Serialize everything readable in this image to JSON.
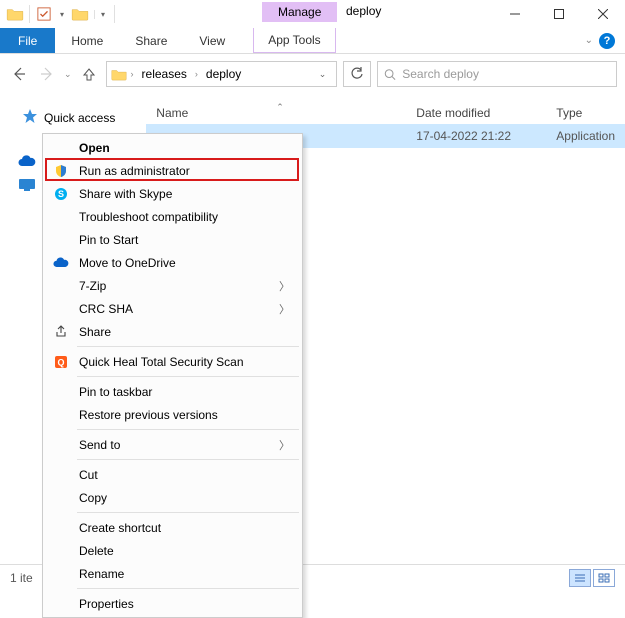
{
  "window": {
    "manage_tab": "Manage",
    "app_tools": "App Tools",
    "title": "deploy"
  },
  "ribbon": {
    "file": "File",
    "home": "Home",
    "share": "Share",
    "view": "View"
  },
  "nav": {
    "breadcrumbs": [
      "releases",
      "deploy"
    ],
    "search_placeholder": "Search deploy"
  },
  "columns": {
    "name": "Name",
    "date": "Date modified",
    "type": "Type"
  },
  "row": {
    "date": "17-04-2022 21:22",
    "type": "Application"
  },
  "sidebar": {
    "quick_access": "Quick access"
  },
  "context_menu": {
    "open": "Open",
    "run_admin": "Run as administrator",
    "share_skype": "Share with Skype",
    "troubleshoot": "Troubleshoot compatibility",
    "pin_start": "Pin to Start",
    "move_onedrive": "Move to OneDrive",
    "seven_zip": "7-Zip",
    "crc_sha": "CRC SHA",
    "share": "Share",
    "quickheal": "Quick Heal Total Security Scan",
    "pin_taskbar": "Pin to taskbar",
    "restore_prev": "Restore previous versions",
    "send_to": "Send to",
    "cut": "Cut",
    "copy": "Copy",
    "create_shortcut": "Create shortcut",
    "delete": "Delete",
    "rename": "Rename",
    "properties": "Properties"
  },
  "status": {
    "text": "1 ite"
  }
}
